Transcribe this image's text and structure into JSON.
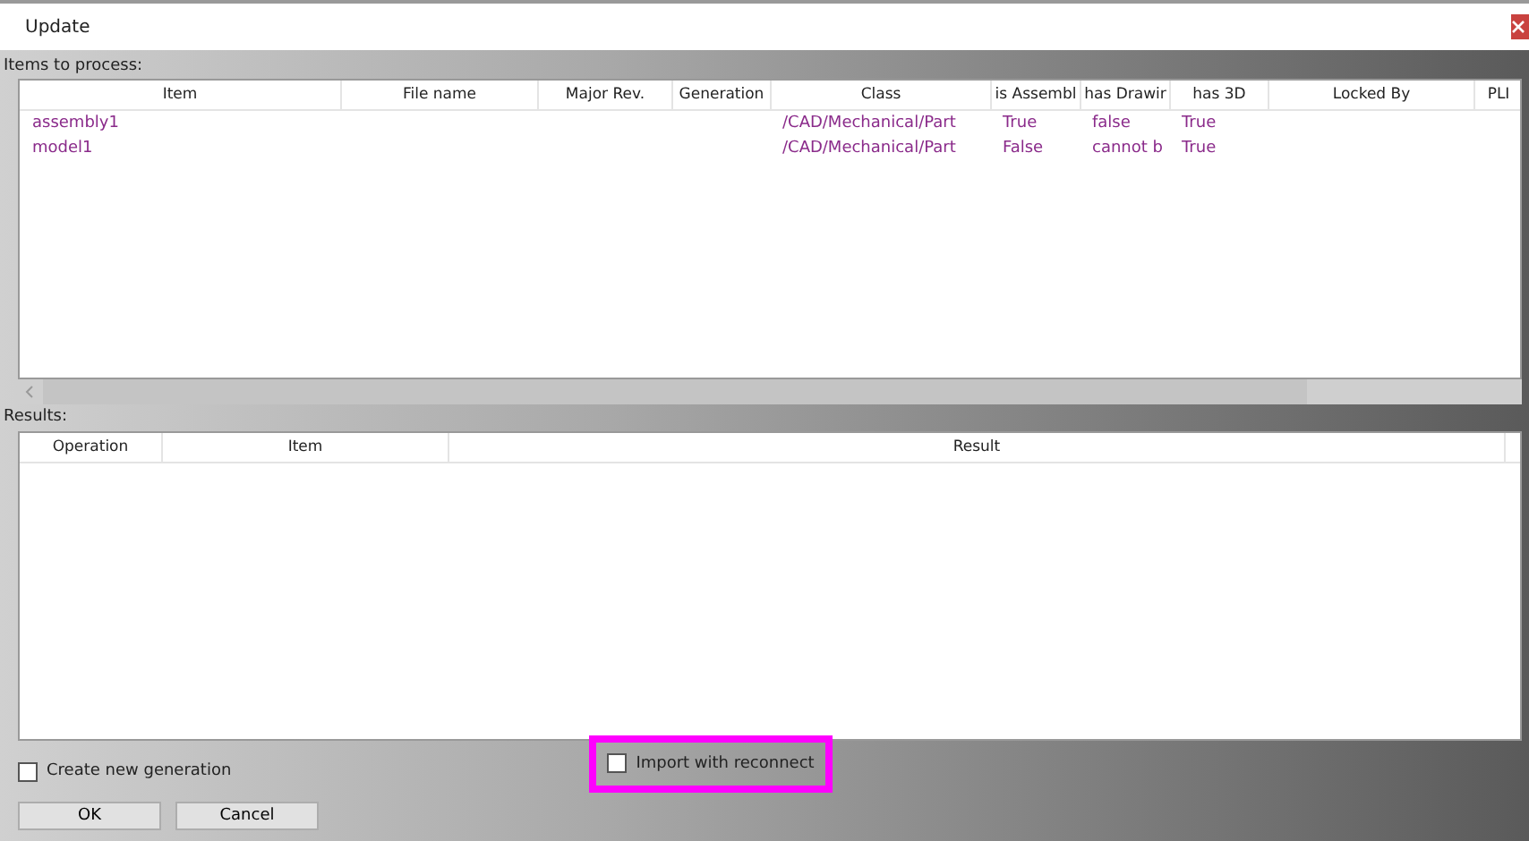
{
  "window": {
    "title": "Update"
  },
  "items_section": {
    "label": "Items to process:"
  },
  "items_table": {
    "columns": [
      "Item",
      "File name",
      "Major Rev.",
      "Generation",
      "Class",
      "is Assembl",
      "has Drawir",
      "has 3D",
      "Locked By",
      "PLI"
    ],
    "rows": [
      {
        "cells": [
          "assembly1",
          "",
          "",
          "",
          "/CAD/Mechanical/Part",
          "True",
          "false",
          "True",
          "",
          ""
        ]
      },
      {
        "cells": [
          "model1",
          "",
          "",
          "",
          "/CAD/Mechanical/Part",
          "False",
          "cannot b",
          "True",
          "",
          ""
        ]
      }
    ]
  },
  "results_section": {
    "label": "Results:"
  },
  "results_table": {
    "columns": [
      "Operation",
      "Item",
      "Result"
    ]
  },
  "options": [
    {
      "label": "Create new generation",
      "checked": false,
      "highlighted": false
    },
    {
      "label": "Import with reconnect",
      "checked": false,
      "highlighted": true
    }
  ],
  "buttons": [
    "OK",
    "Cancel"
  ]
}
